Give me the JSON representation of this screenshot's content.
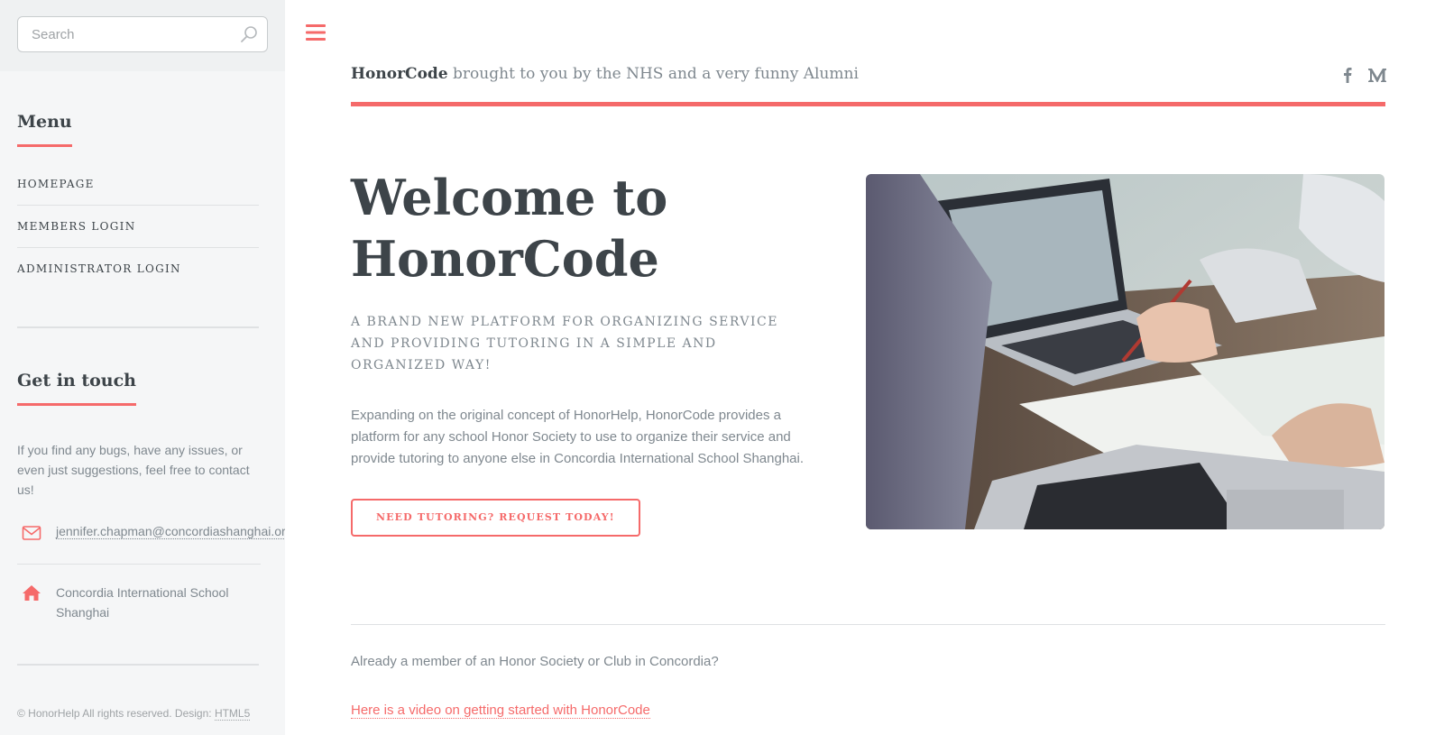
{
  "colors": {
    "accent": "#f56a6a",
    "heading": "#3d4449",
    "text": "#7f888f",
    "sidebar_bg": "#f5f6f7"
  },
  "sidebar": {
    "search": {
      "placeholder": "Search",
      "value": "",
      "icon": "search-icon"
    },
    "menu": {
      "heading": "Menu",
      "items": [
        {
          "label": "HOMEPAGE"
        },
        {
          "label": "MEMBERS LOGIN"
        },
        {
          "label": "ADMINISTRATOR LOGIN"
        }
      ]
    },
    "contact": {
      "heading": "Get in touch",
      "text": "If you find any bugs, have any issues, or even just suggestions, feel free to contact us!",
      "email": "jennifer.chapman@concordiashanghai.org",
      "email_icon": "envelope-icon",
      "address": "Concordia International School Shanghai",
      "address_icon": "home-icon"
    },
    "footer": {
      "text": "© HonorHelp All rights reserved. Design: ",
      "link": "HTML5"
    }
  },
  "header": {
    "toggle_icon": "hamburger-icon",
    "brand": "HonorCode",
    "tagline": "brought to you by the NHS and a very funny Alumni",
    "social": [
      "facebook-icon",
      "medium-icon"
    ]
  },
  "banner": {
    "title_line1": "Welcome to",
    "title_line2": "HonorCode",
    "subtitle": "A BRAND NEW PLATFORM FOR ORGANIZING SERVICE AND PROVIDING TUTORING IN A SIMPLE AND ORGANIZED WAY!",
    "body": "Expanding on the original concept of HonorHelp, HonorCode provides a platform for any school Honor Society to use to organize their service and provide tutoring to anyone else in Concordia International School Shanghai.",
    "cta": "NEED TUTORING? REQUEST TODAY!",
    "image": "laptops-workspace-photo"
  },
  "section": {
    "member_text": "Already a member of an Honor Society or Club in Concordia?",
    "video_link": "Here is a video on getting started with HonorCode"
  }
}
